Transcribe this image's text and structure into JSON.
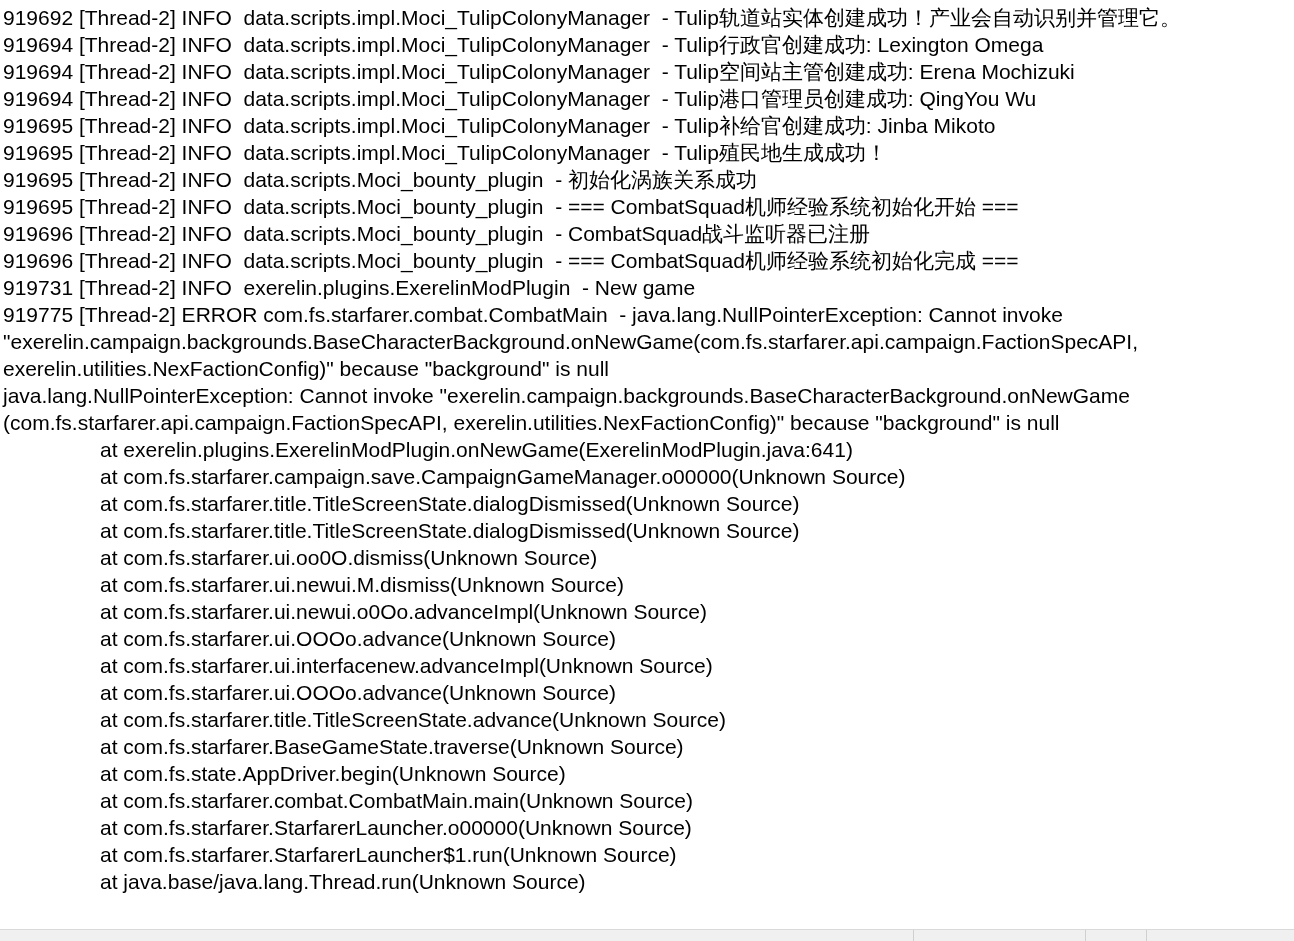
{
  "editor": {
    "lines": [
      {
        "kind": "log",
        "text": "919692 [Thread-2] INFO  data.scripts.impl.Moci_TulipColonyManager  - Tulip轨道站实体创建成功！产业会自动识别并管理它。"
      },
      {
        "kind": "log",
        "text": "919694 [Thread-2] INFO  data.scripts.impl.Moci_TulipColonyManager  - Tulip行政官创建成功: Lexington Omega"
      },
      {
        "kind": "log",
        "text": "919694 [Thread-2] INFO  data.scripts.impl.Moci_TulipColonyManager  - Tulip空间站主管创建成功: Erena Mochizuki"
      },
      {
        "kind": "log",
        "text": "919694 [Thread-2] INFO  data.scripts.impl.Moci_TulipColonyManager  - Tulip港口管理员创建成功: QingYou Wu"
      },
      {
        "kind": "log",
        "text": "919695 [Thread-2] INFO  data.scripts.impl.Moci_TulipColonyManager  - Tulip补给官创建成功: Jinba Mikoto"
      },
      {
        "kind": "log",
        "text": "919695 [Thread-2] INFO  data.scripts.impl.Moci_TulipColonyManager  - Tulip殖民地生成成功！"
      },
      {
        "kind": "log",
        "text": "919695 [Thread-2] INFO  data.scripts.Moci_bounty_plugin  - 初始化涡族关系成功"
      },
      {
        "kind": "log",
        "text": "919695 [Thread-2] INFO  data.scripts.Moci_bounty_plugin  - === CombatSquad机师经验系统初始化开始 ==="
      },
      {
        "kind": "log",
        "text": "919696 [Thread-2] INFO  data.scripts.Moci_bounty_plugin  - CombatSquad战斗监听器已注册"
      },
      {
        "kind": "log",
        "text": "919696 [Thread-2] INFO  data.scripts.Moci_bounty_plugin  - === CombatSquad机师经验系统初始化完成 ==="
      },
      {
        "kind": "log",
        "text": "919731 [Thread-2] INFO  exerelin.plugins.ExerelinModPlugin  - New game"
      },
      {
        "kind": "log",
        "wrapped_lines": [
          "919775 [Thread-2] ERROR com.fs.starfarer.combat.CombatMain  - java.lang.NullPointerException: Cannot invoke",
          "\"exerelin.campaign.backgrounds.BaseCharacterBackground.onNewGame(com.fs.starfarer.api.campaign.FactionSpecAPI,",
          "exerelin.utilities.NexFactionConfig)\" because \"background\" is null"
        ]
      },
      {
        "kind": "log",
        "wrapped_lines": [
          "java.lang.NullPointerException: Cannot invoke \"exerelin.campaign.backgrounds.BaseCharacterBackground.onNewGame",
          "(com.fs.starfarer.api.campaign.FactionSpecAPI, exerelin.utilities.NexFactionConfig)\" because \"background\" is null"
        ]
      },
      {
        "kind": "trace",
        "text": "at exerelin.plugins.ExerelinModPlugin.onNewGame(ExerelinModPlugin.java:641)"
      },
      {
        "kind": "trace",
        "text": "at com.fs.starfarer.campaign.save.CampaignGameManager.o00000(Unknown Source)"
      },
      {
        "kind": "trace",
        "text": "at com.fs.starfarer.title.TitleScreenState.dialogDismissed(Unknown Source)"
      },
      {
        "kind": "trace",
        "text": "at com.fs.starfarer.title.TitleScreenState.dialogDismissed(Unknown Source)"
      },
      {
        "kind": "trace",
        "text": "at com.fs.starfarer.ui.oo0O.dismiss(Unknown Source)"
      },
      {
        "kind": "trace",
        "text": "at com.fs.starfarer.ui.newui.M.dismiss(Unknown Source)"
      },
      {
        "kind": "trace",
        "text": "at com.fs.starfarer.ui.newui.o0Oo.advanceImpl(Unknown Source)"
      },
      {
        "kind": "trace",
        "text": "at com.fs.starfarer.ui.OOOo.advance(Unknown Source)"
      },
      {
        "kind": "trace",
        "text": "at com.fs.starfarer.ui.interfacenew.advanceImpl(Unknown Source)"
      },
      {
        "kind": "trace",
        "text": "at com.fs.starfarer.ui.OOOo.advance(Unknown Source)"
      },
      {
        "kind": "trace",
        "text": "at com.fs.starfarer.title.TitleScreenState.advance(Unknown Source)"
      },
      {
        "kind": "trace",
        "text": "at com.fs.starfarer.BaseGameState.traverse(Unknown Source)"
      },
      {
        "kind": "trace",
        "text": "at com.fs.state.AppDriver.begin(Unknown Source)"
      },
      {
        "kind": "trace",
        "text": "at com.fs.starfarer.combat.CombatMain.main(Unknown Source)"
      },
      {
        "kind": "trace",
        "text": "at com.fs.starfarer.StarfarerLauncher.o00000(Unknown Source)"
      },
      {
        "kind": "trace",
        "text": "at com.fs.starfarer.StarfarerLauncher$1.run(Unknown Source)"
      },
      {
        "kind": "trace",
        "text": "at java.base/java.lang.Thread.run(Unknown Source)"
      }
    ]
  }
}
